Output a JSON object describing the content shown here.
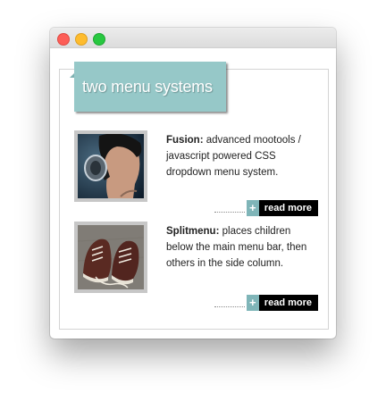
{
  "window": {
    "controls": [
      "close",
      "minimize",
      "zoom"
    ]
  },
  "module": {
    "title": "two menu systems",
    "items": [
      {
        "name": "Fusion:",
        "text": " advanced mootools / javascript powered CSS dropdown menu system.",
        "read_more": "read more",
        "plus": "+",
        "image": "man-headphones-photo"
      },
      {
        "name": "Splitmenu:",
        "text": " places children below the main menu bar, then others in the side column.",
        "read_more": "read more",
        "plus": "+",
        "image": "sneakers-photo"
      }
    ]
  },
  "colors": {
    "accent": "#96c8c8",
    "button_bg": "#000000",
    "plus_bg": "#7fb5b8"
  }
}
